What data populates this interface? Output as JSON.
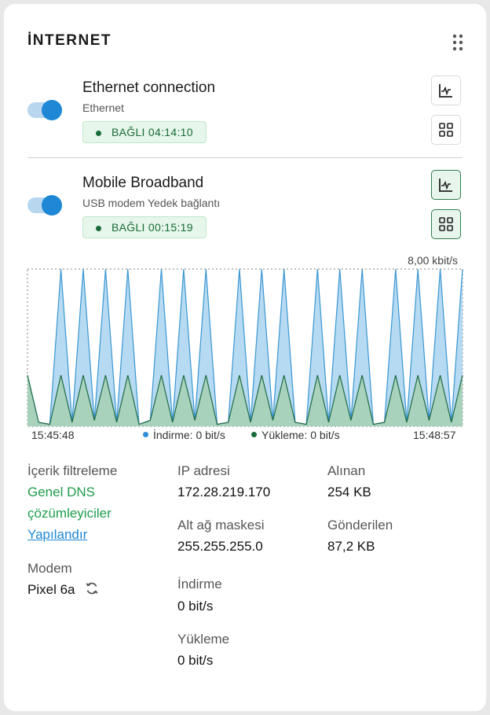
{
  "widget": {
    "title": "İNTERNET",
    "menu_icon": "kebab-menu-icon"
  },
  "connections": [
    {
      "name": "Ethernet connection",
      "subtitle": "Ethernet",
      "enabled": true,
      "status": "BAĞLI 04:14:10",
      "chart_icon": "line-chart-icon",
      "grid_icon": "grid-icon",
      "chart_active": false
    },
    {
      "name": "Mobile Broadband",
      "subtitle": "USB modem Yedek bağlantı",
      "enabled": true,
      "status": "BAĞLI 00:15:19",
      "chart_icon": "line-chart-icon",
      "grid_icon": "grid-icon",
      "chart_active": true
    }
  ],
  "chart_data": {
    "type": "area",
    "max_label": "8,00 kbit/s",
    "x_start": "15:45:48",
    "x_end": "15:48:57",
    "series": [
      {
        "name": "İndirme: 0 bit/s",
        "color": "#a9d4ef",
        "stroke": "#3a96d2",
        "values": [
          2.6,
          0.2,
          0.1,
          8,
          0.2,
          8,
          0.3,
          8,
          0.2,
          8,
          0.1,
          0.3,
          8,
          0.2,
          8,
          0.3,
          8,
          0.1,
          0.2,
          8,
          0.2,
          8,
          0.3,
          8,
          0.2,
          0.1,
          8,
          0.2,
          8,
          0.3,
          8,
          0.1,
          0.2,
          8,
          0.2,
          8,
          0.3,
          8,
          0.2,
          8
        ]
      },
      {
        "name": "Yükleme: 0 bit/s",
        "color": "#a7d0b6",
        "stroke": "#1e6b45",
        "values": [
          2.6,
          0.2,
          0.1,
          2.6,
          0.2,
          2.6,
          0.3,
          2.6,
          0.2,
          2.6,
          0.1,
          0.3,
          2.6,
          0.2,
          2.6,
          0.3,
          2.6,
          0.1,
          0.2,
          2.6,
          0.2,
          2.6,
          0.3,
          2.6,
          0.2,
          0.1,
          2.6,
          0.2,
          2.6,
          0.3,
          2.6,
          0.1,
          0.2,
          2.6,
          0.2,
          2.6,
          0.3,
          2.6,
          0.2,
          2.6
        ]
      }
    ],
    "ylim": [
      0,
      8
    ]
  },
  "legend": {
    "download": "İndirme: 0 bit/s",
    "download_color": "#2f8fd8",
    "upload": "Yükleme: 0 bit/s",
    "upload_color": "#1a6b3a"
  },
  "details": {
    "content_filter_label": "İçerik filtreleme",
    "content_filter_value_1": "Genel DNS",
    "content_filter_value_2": "çözümleyiciler",
    "configure_link": "Yapılandır",
    "modem_label": "Modem",
    "modem_value": "Pixel 6a",
    "sync_icon": "sync-icon",
    "ip_label": "IP adresi",
    "ip_value": "172.28.219.170",
    "subnet_label": "Alt ağ maskesi",
    "subnet_value": "255.255.255.0",
    "download_label": "İndirme",
    "download_value": "0 bit/s",
    "upload_label": "Yükleme",
    "upload_value": "0 bit/s",
    "received_label": "Alınan",
    "received_value": "254 KB",
    "sent_label": "Gönderilen",
    "sent_value": "87,2 KB"
  }
}
